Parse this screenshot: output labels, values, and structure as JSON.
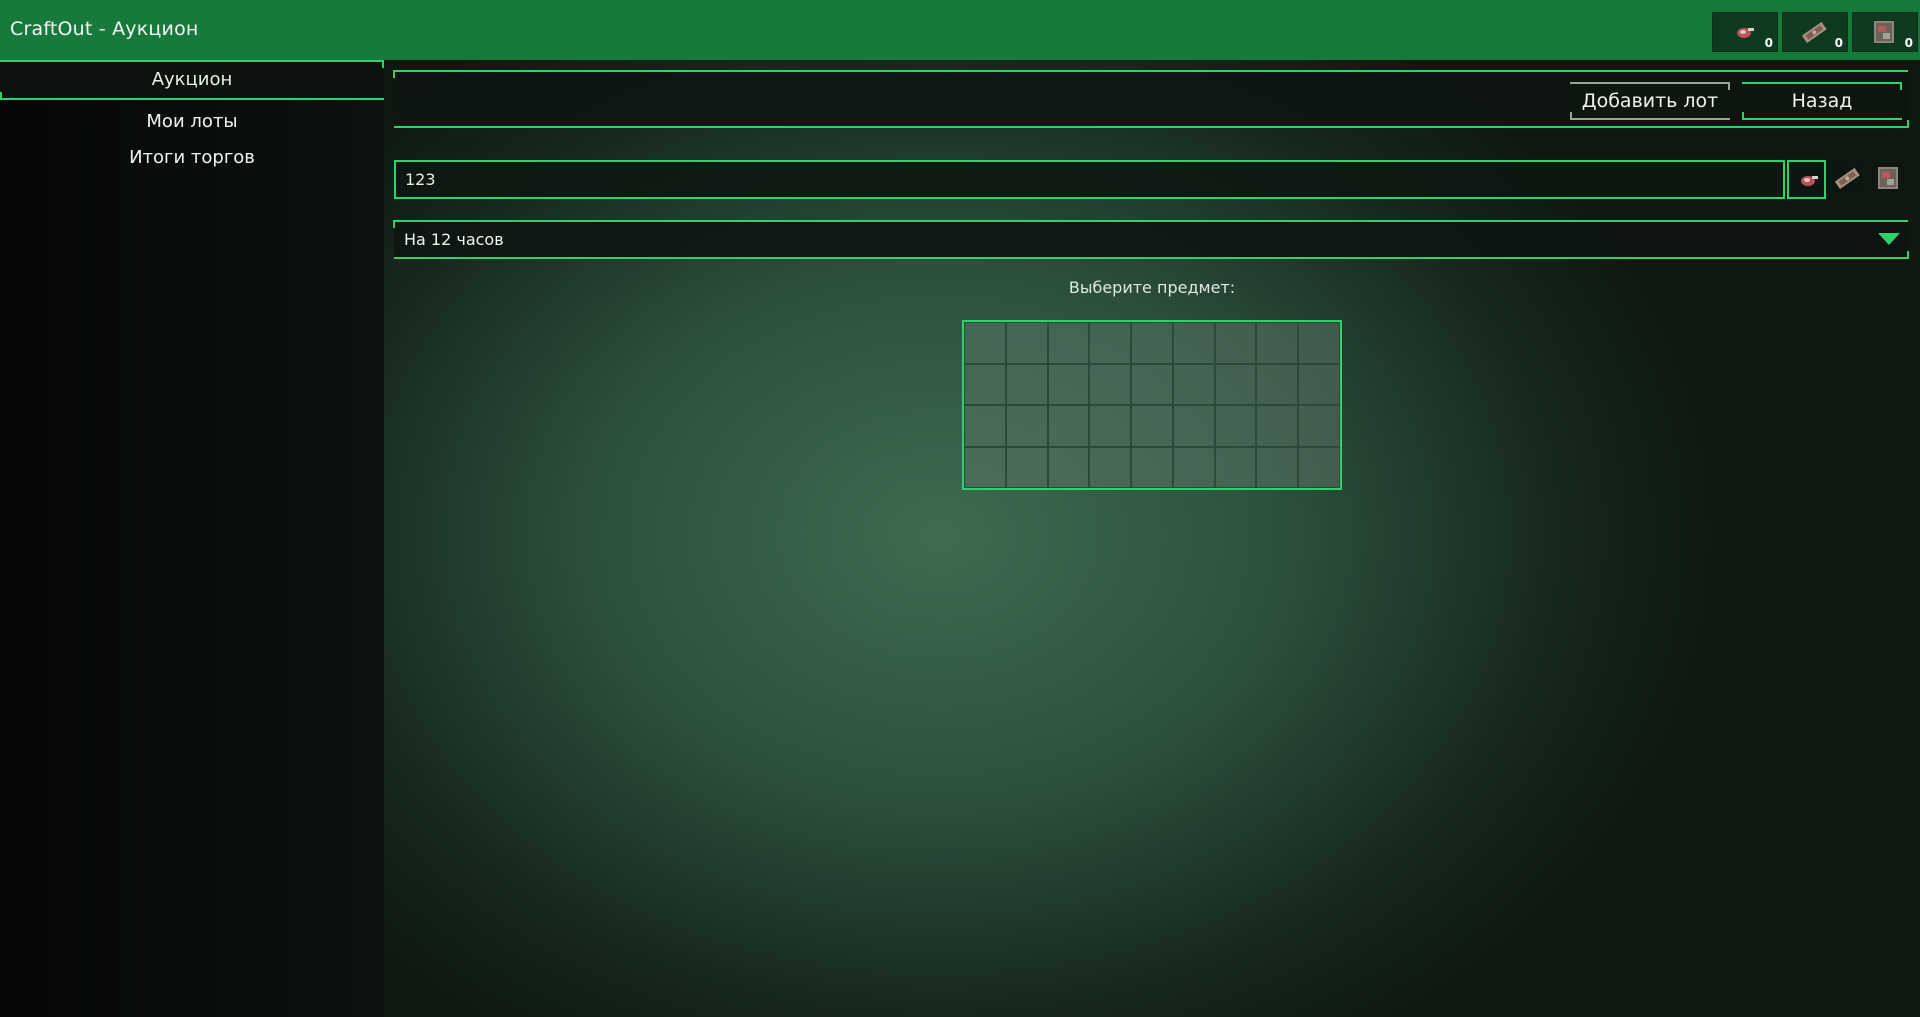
{
  "window": {
    "title": "CraftOut - Аукцион"
  },
  "currencies": [
    {
      "icon": "meat-currency-icon",
      "count": "0"
    },
    {
      "icon": "banknote-currency-icon",
      "count": "0"
    },
    {
      "icon": "crate-currency-icon",
      "count": "0"
    }
  ],
  "sidebar": {
    "active_tab": "Аукцион",
    "items": [
      {
        "label": "Мои лоты"
      },
      {
        "label": "Итоги торгов"
      }
    ]
  },
  "toolbar": {
    "add_label": "Добавить лот",
    "back_label": "Назад"
  },
  "price": {
    "value": "123",
    "currency_options": [
      "meat-currency-icon",
      "banknote-currency-icon",
      "crate-currency-icon"
    ],
    "selected_currency": "meat-currency-icon"
  },
  "duration": {
    "selected": "На 12 часов"
  },
  "item_picker": {
    "prompt": "Выберите предмет:",
    "rows": 4,
    "columns": 9
  },
  "colors": {
    "accent": "#2fd16a",
    "titlebar": "#177a3c"
  }
}
